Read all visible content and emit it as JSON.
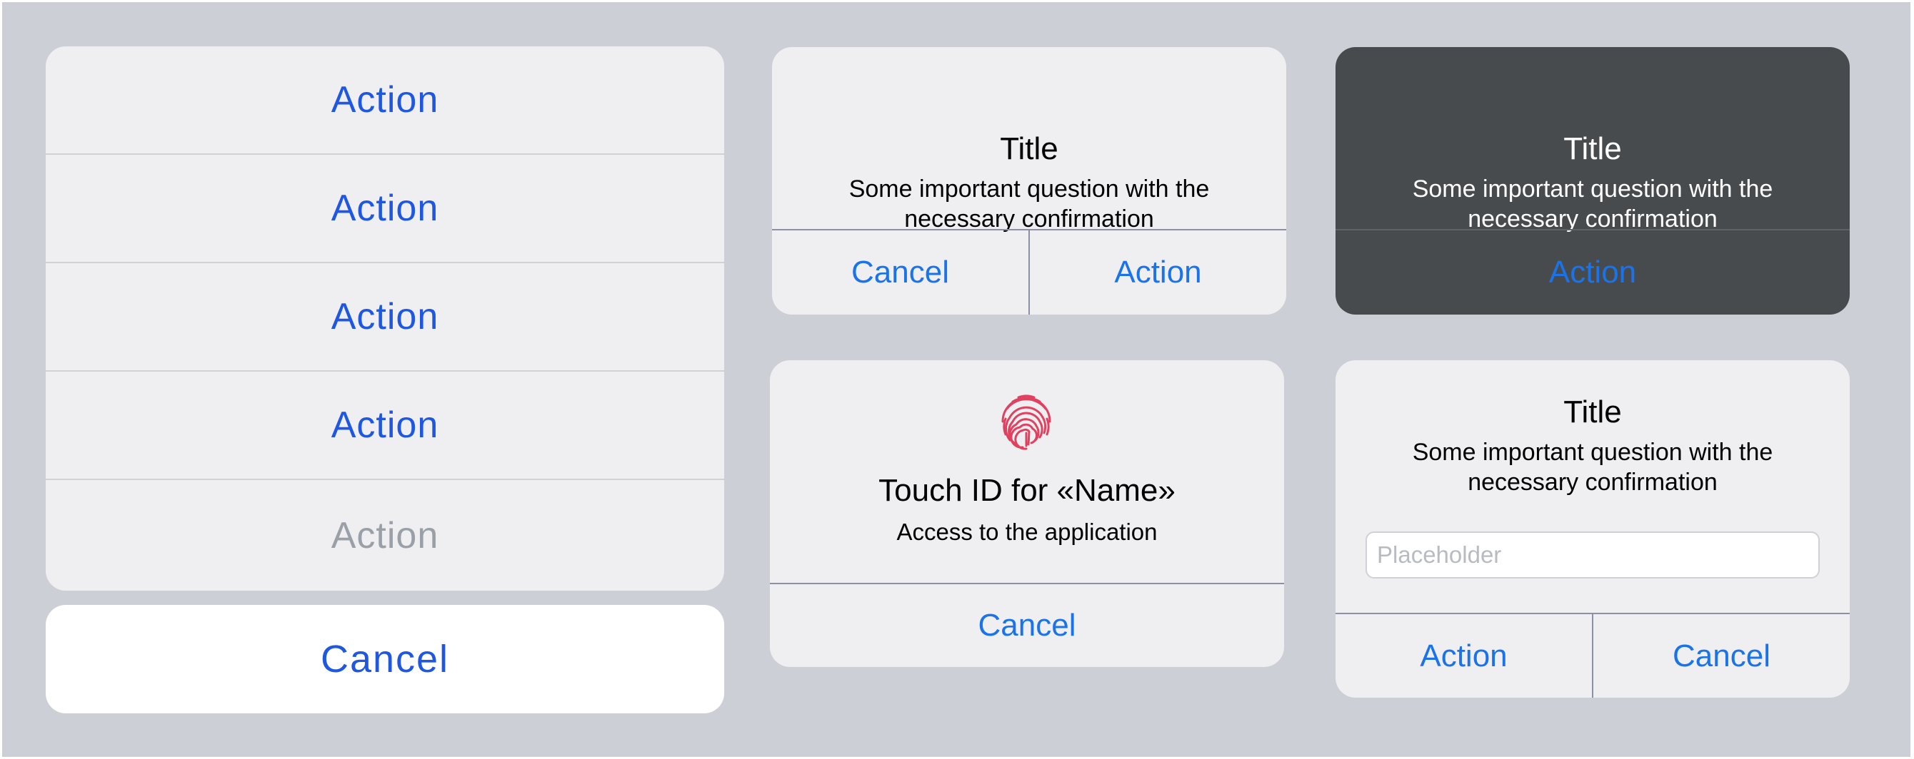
{
  "action_sheet": {
    "items": [
      {
        "label": "Action",
        "enabled": true
      },
      {
        "label": "Action",
        "enabled": true
      },
      {
        "label": "Action",
        "enabled": true
      },
      {
        "label": "Action",
        "enabled": true
      },
      {
        "label": "Action",
        "enabled": false
      }
    ],
    "cancel_label": "Cancel"
  },
  "alert_two_buttons": {
    "title": "Title",
    "message_line1": "Some important question with the",
    "message_line2": "necessary confirmation",
    "cancel_label": "Cancel",
    "action_label": "Action"
  },
  "alert_dark": {
    "title": "Title",
    "message_line1": "Some important question with the",
    "message_line2": "necessary confirmation",
    "action_label": "Action"
  },
  "alert_touch_id": {
    "icon": "fingerprint-icon",
    "title": "Touch ID for «Name»",
    "message": "Access to the application",
    "cancel_label": "Cancel"
  },
  "alert_input": {
    "title": "Title",
    "message_line1": "Some important question with the",
    "message_line2": "necessary confirmation",
    "input_placeholder": "Placeholder",
    "input_value": "",
    "action_label": "Action",
    "cancel_label": "Cancel"
  },
  "colors": {
    "background": "#ccd0d6",
    "card": "#efeff2",
    "dark_card": "#484b4e",
    "sheet_action": "#1f57e0",
    "alert_button": "#1a73e8",
    "disabled": "#9a9fa8",
    "fingerprint": "#e0415f"
  }
}
